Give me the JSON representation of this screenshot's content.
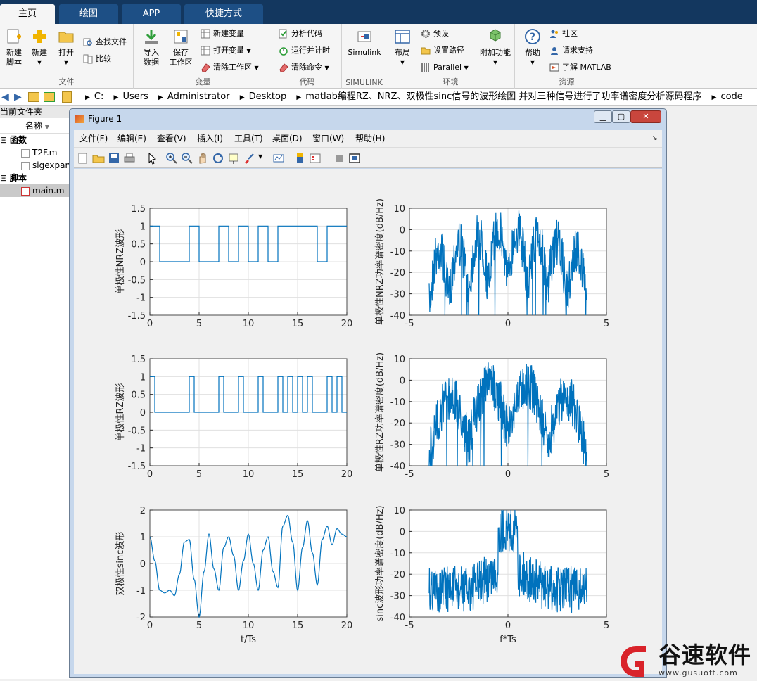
{
  "tabs": [
    {
      "label": "主页",
      "active": true
    },
    {
      "label": "绘图",
      "active": false
    },
    {
      "label": "APP",
      "active": false
    },
    {
      "label": "快捷方式",
      "active": false
    }
  ],
  "ribbon": {
    "groups": [
      {
        "label": "文件",
        "buttons": [
          "新建\n脚本",
          "新建",
          "打开",
          "查找文件",
          "比较"
        ]
      },
      {
        "label": "变量",
        "buttons": [
          "导入\n数据",
          "保存\n工作区",
          "新建变量",
          "打开变量",
          "清除工作区"
        ]
      },
      {
        "label": "代码",
        "buttons": [
          "分析代码",
          "运行并计时",
          "清除命令"
        ]
      },
      {
        "label": "SIMULINK",
        "buttons": [
          "Simulink"
        ]
      },
      {
        "label": "环境",
        "buttons": [
          "布局",
          "预设",
          "设置路径",
          "Parallel",
          "附加功能"
        ]
      },
      {
        "label": "资源",
        "buttons": [
          "帮助",
          "社区",
          "请求支持",
          "了解 MATLAB"
        ]
      }
    ]
  },
  "address": {
    "crumbs": [
      "C:",
      "Users",
      "Administrator",
      "Desktop",
      "matlab编程RZ、NRZ、双极性sinc信号的波形绘图 并对三种信号进行了功率谱密度分析源码程序",
      "code"
    ]
  },
  "current_folder": {
    "title": "当前文件夹",
    "column": "名称",
    "sections": [
      {
        "label": "函数",
        "items": [
          "T2F.m",
          "sigexpan"
        ]
      },
      {
        "label": "脚本",
        "items": [
          "main.m"
        ]
      }
    ]
  },
  "figure": {
    "title": "Figure 1",
    "menu": [
      "文件(F)",
      "编辑(E)",
      "查看(V)",
      "插入(I)",
      "工具(T)",
      "桌面(D)",
      "窗口(W)",
      "帮助(H)"
    ]
  },
  "chart_data": [
    {
      "type": "line",
      "ylabel": "单极性NRZ波形",
      "xlim": [
        0,
        20
      ],
      "ylim": [
        -1.5,
        1.5
      ],
      "xticks": [
        "0",
        "5",
        "10",
        "15",
        "20"
      ],
      "yticks": [
        "1.5",
        "1",
        "0.5",
        "0",
        "-0.5",
        "-1",
        "-1.5"
      ],
      "bits": [
        1,
        0,
        0,
        0,
        1,
        0,
        0,
        1,
        0,
        1,
        0,
        1,
        0,
        1,
        1,
        1,
        1,
        0,
        1,
        1
      ]
    },
    {
      "type": "line",
      "ylabel": "单极性NRZ功率谱密度(dB/Hz)",
      "xlim": [
        -5,
        5
      ],
      "ylim": [
        -40,
        10
      ],
      "xticks": [
        "-5",
        "0",
        "5"
      ],
      "yticks": [
        "10",
        "0",
        "-10",
        "-20",
        "-30",
        "-40"
      ]
    },
    {
      "type": "line",
      "ylabel": "单极性RZ波形",
      "xlim": [
        0,
        20
      ],
      "ylim": [
        -1.5,
        1.5
      ],
      "xticks": [
        "0",
        "5",
        "10",
        "15",
        "20"
      ],
      "yticks": [
        "1.5",
        "1",
        "0.5",
        "0",
        "-0.5",
        "-1",
        "-1.5"
      ],
      "bits": [
        1,
        0,
        0,
        0,
        1,
        0,
        0,
        1,
        0,
        1,
        0,
        1,
        0,
        1,
        1,
        1,
        1,
        0,
        1,
        1
      ]
    },
    {
      "type": "line",
      "ylabel": "单极性RZ功率谱密度(dB/Hz)",
      "xlim": [
        -5,
        5
      ],
      "ylim": [
        -40,
        10
      ],
      "xticks": [
        "-5",
        "0",
        "5"
      ],
      "yticks": [
        "10",
        "0",
        "-10",
        "-20",
        "-30",
        "-40"
      ]
    },
    {
      "type": "line",
      "ylabel": "双极性sinc波形",
      "xlabel": "t/Ts",
      "xlim": [
        0,
        20
      ],
      "ylim": [
        -2,
        2
      ],
      "xticks": [
        "0",
        "5",
        "10",
        "15",
        "20"
      ],
      "yticks": [
        "2",
        "1",
        "0",
        "-1",
        "-2"
      ],
      "x": [
        0,
        0.5,
        1,
        1.5,
        2,
        2.5,
        3,
        3.5,
        4,
        4.5,
        5,
        5.5,
        6,
        6.5,
        7,
        7.5,
        8,
        8.5,
        9,
        9.5,
        10,
        10.5,
        11,
        11.5,
        12,
        12.5,
        13,
        13.5,
        14,
        14.5,
        15,
        15.5,
        16,
        16.5,
        17,
        17.5,
        18,
        18.5,
        19,
        19.5,
        20
      ],
      "y": [
        1.0,
        0.1,
        -1.0,
        -1.1,
        -1.0,
        -1.2,
        -0.4,
        0.8,
        0.9,
        -0.6,
        -2.0,
        -0.3,
        1.1,
        -0.2,
        -1.0,
        0.6,
        1.0,
        0.3,
        -1.0,
        0.1,
        1.1,
        0.0,
        -1.0,
        0.5,
        1.0,
        -0.3,
        -0.9,
        1.4,
        1.8,
        0.8,
        -1.0,
        0.6,
        1.6,
        0.4,
        -0.8,
        0.9,
        1.4,
        0.7,
        1.3,
        1.1,
        1.0
      ]
    },
    {
      "type": "line",
      "ylabel": "sinc波形功率谱密度(dB/Hz)",
      "xlabel": "f*Ts",
      "xlim": [
        -5,
        5
      ],
      "ylim": [
        -40,
        10
      ],
      "xticks": [
        "-5",
        "0",
        "5"
      ],
      "yticks": [
        "10",
        "0",
        "-10",
        "-20",
        "-30",
        "-40"
      ]
    }
  ],
  "watermark": {
    "brand": "谷速软件",
    "url": "www.gusuoft.com"
  },
  "colors": {
    "line": "#0072bd",
    "tabbar": "#13375f",
    "logo_red": "#d9232a"
  }
}
